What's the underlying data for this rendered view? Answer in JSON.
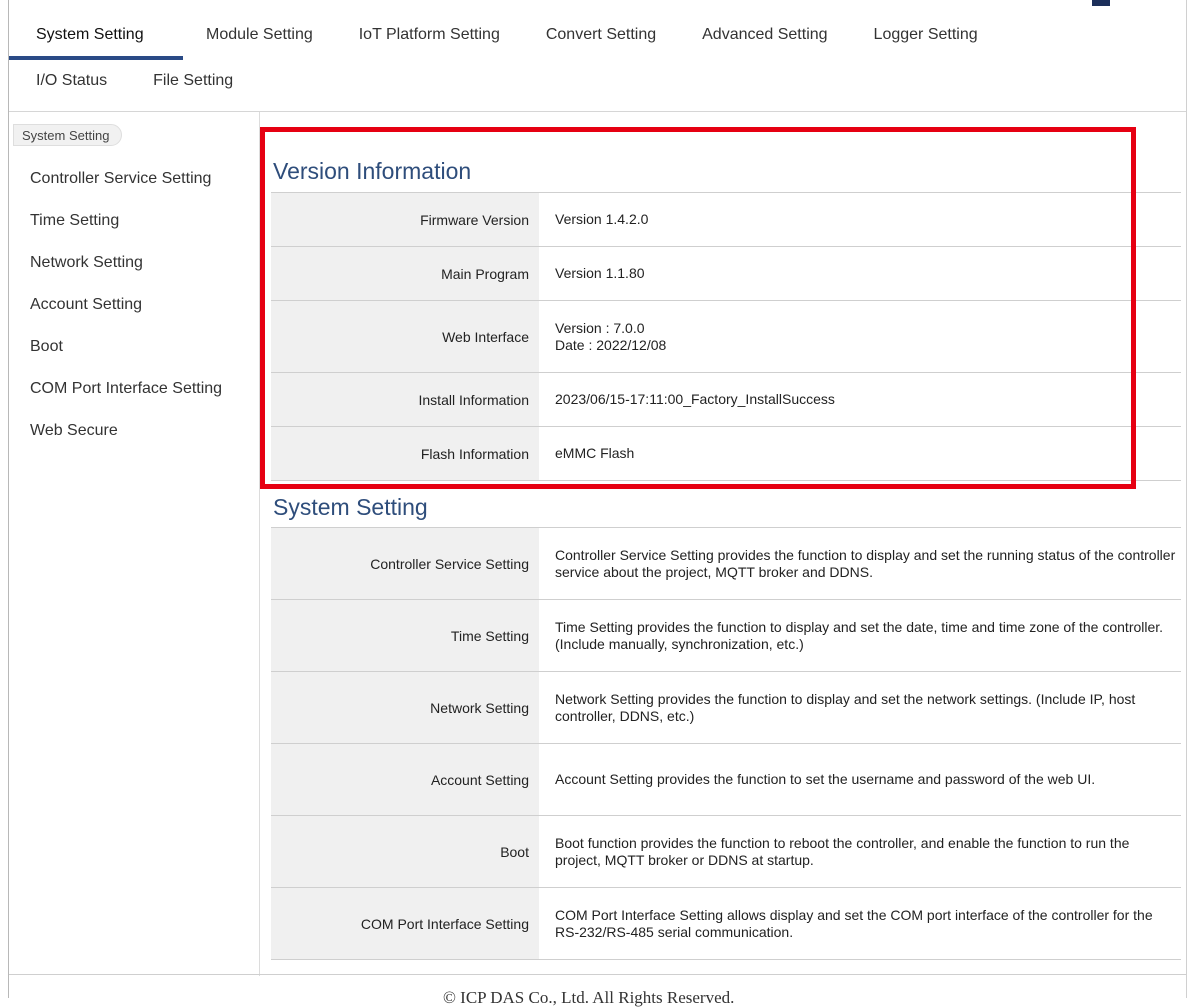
{
  "tabs_row1": [
    "System Setting",
    "Module Setting",
    "IoT Platform Setting",
    "Convert Setting",
    "Advanced Setting",
    "Logger Setting"
  ],
  "tabs_row2": [
    "I/O Status",
    "File Setting"
  ],
  "breadcrumb": "System Setting",
  "sidebar": {
    "items": [
      "Controller Service Setting",
      "Time Setting",
      "Network Setting",
      "Account Setting",
      "Boot",
      "COM Port Interface Setting",
      "Web Secure"
    ]
  },
  "version_info": {
    "title": "Version Information",
    "rows": [
      {
        "label": "Firmware Version",
        "value": "Version 1.4.2.0",
        "value2": ""
      },
      {
        "label": "Main Program",
        "value": "Version 1.1.80",
        "value2": ""
      },
      {
        "label": "Web Interface",
        "value": "Version : 7.0.0",
        "value2": "Date : 2022/12/08"
      },
      {
        "label": "Install Information",
        "value": "2023/06/15-17:11:00_Factory_InstallSuccess",
        "value2": ""
      },
      {
        "label": "Flash Information",
        "value": "eMMC Flash",
        "value2": ""
      }
    ]
  },
  "system_setting": {
    "title": "System Setting",
    "rows": [
      {
        "label": "Controller Service Setting",
        "desc": "Controller Service Setting provides the function to display and set the running status of the controller service about the project, MQTT broker and DDNS."
      },
      {
        "label": "Time Setting",
        "desc": "Time Setting provides the function to display and set the date, time and time zone of the controller. (Include manually, synchronization, etc.)"
      },
      {
        "label": "Network Setting",
        "desc": "Network Setting provides the function to display and set the network settings. (Include IP, host controller, DDNS, etc.)"
      },
      {
        "label": "Account Setting",
        "desc": "Account Setting provides the function to set the username and password of the web UI."
      },
      {
        "label": "Boot",
        "desc": "Boot function provides the function to reboot the controller, and enable the function to run the project, MQTT broker or DDNS at startup."
      },
      {
        "label": "COM Port Interface Setting",
        "desc": "COM Port Interface Setting allows display and set the COM port interface of the controller for the RS-232/RS-485 serial communication."
      }
    ]
  },
  "footer": "© ICP DAS Co., Ltd. All Rights Reserved.",
  "colors": {
    "accent": "#2a4a86",
    "title": "#2e4d7b",
    "highlight": "#e60012"
  }
}
